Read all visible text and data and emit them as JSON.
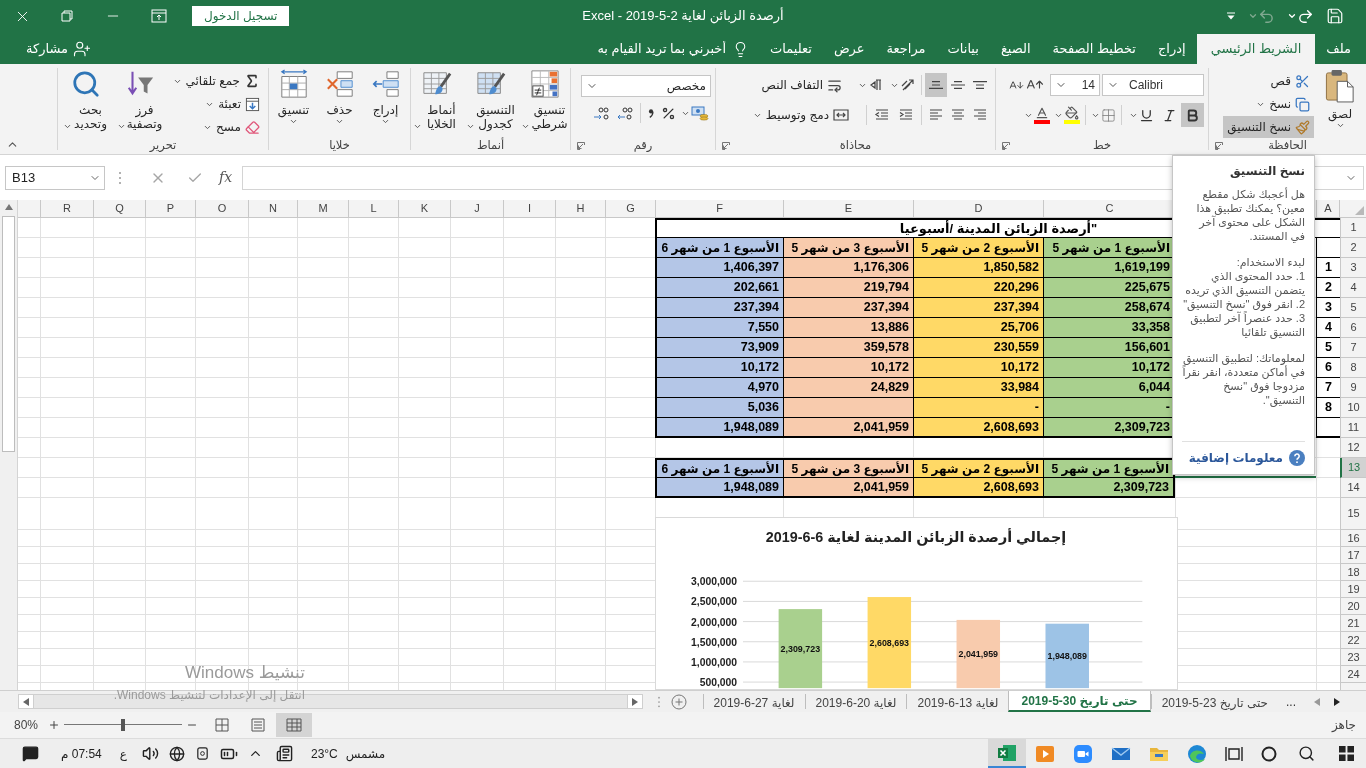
{
  "title_bar": {
    "title": "أرصدة الزبائن لغاية 2-5-2019 - Excel",
    "sign_in": "تسجيل الدخول"
  },
  "ribbon_tabs": [
    {
      "label": "ملف",
      "selected": false
    },
    {
      "label": "الشريط الرئيسي",
      "selected": true
    },
    {
      "label": "إدراج",
      "selected": false
    },
    {
      "label": "تخطيط الصفحة",
      "selected": false
    },
    {
      "label": "الصيغ",
      "selected": false
    },
    {
      "label": "بيانات",
      "selected": false
    },
    {
      "label": "مراجعة",
      "selected": false
    },
    {
      "label": "عرض",
      "selected": false
    },
    {
      "label": "تعليمات",
      "selected": false
    }
  ],
  "tell_me": {
    "placeholder": "أخبرني بما تريد القيام به"
  },
  "share": "مشاركة",
  "ribbon": {
    "clipboard": {
      "label": "الحافظة",
      "paste": "لصق",
      "cut": "قص",
      "copy": "نسخ",
      "format_painter": {
        "label": "نسخ التنسيق",
        "highlighted": true
      }
    },
    "font": {
      "label": "خط",
      "font_name": "Calibri",
      "font_size": "14",
      "bold": true,
      "italic": false,
      "underline": false
    },
    "alignment": {
      "label": "محاذاة",
      "wrap_text": "التفاف النص",
      "merge_center": "دمج وتوسيط",
      "vertical_align": [
        {
          "selected": false
        },
        {
          "selected": false
        },
        {
          "selected": true
        }
      ]
    },
    "number": {
      "label": "رقم",
      "format": "مخصص"
    },
    "styles": {
      "label": "أنماط",
      "buttons": [
        "تنسيق شرطي",
        "التنسيق كجدول",
        "أنماط الخلايا"
      ]
    },
    "cells": {
      "label": "خلايا",
      "buttons": [
        "إدراج",
        "حذف",
        "تنسيق"
      ]
    },
    "editing": {
      "label": "تحرير",
      "autosum": "جمع تلقائي",
      "fill": "تعبئة",
      "clear": "مسح",
      "sort_filter": "فرز وتصفية",
      "find_select": "بحث وتحديد"
    }
  },
  "formula_bar": {
    "name_box": "B13",
    "insert_function": "fx"
  },
  "sheet": {
    "columns": [
      "A",
      null,
      "C",
      "D",
      "E",
      "F",
      "G",
      "H",
      "I",
      "J",
      "K",
      "L",
      "M",
      "N",
      "O",
      "P",
      "Q",
      "R"
    ],
    "rows": [
      {
        "label": "1",
        "selected": false
      },
      {
        "label": "2",
        "selected": false
      },
      {
        "label": "3",
        "selected": false
      },
      {
        "label": "4",
        "selected": false
      },
      {
        "label": "5",
        "selected": false
      },
      {
        "label": "6",
        "selected": false
      },
      {
        "label": "7",
        "selected": false
      },
      {
        "label": "8",
        "selected": false
      },
      {
        "label": "9",
        "selected": false
      },
      {
        "label": "10",
        "selected": false
      },
      {
        "label": "11",
        "selected": false
      },
      {
        "label": "12",
        "selected": false
      },
      {
        "label": "13",
        "selected": true
      },
      {
        "label": "14",
        "selected": false
      },
      {
        "label": "15",
        "selected": false
      },
      {
        "label": "16",
        "selected": false
      },
      {
        "label": "17",
        "selected": false
      },
      {
        "label": "18",
        "selected": false
      },
      {
        "label": "19",
        "selected": false
      },
      {
        "label": "20",
        "selected": false
      },
      {
        "label": "21",
        "selected": false
      },
      {
        "label": "22",
        "selected": false
      },
      {
        "label": "23",
        "selected": false
      },
      {
        "label": "24",
        "selected": false
      }
    ],
    "table": {
      "title": "\"أرصدة الزبائن المدينة /أسبوعيا",
      "serials": [
        "1",
        "2",
        "3",
        "4",
        "5",
        "6",
        "7",
        "8"
      ],
      "columns": [
        {
          "header": "الأسبوع 1 من شهر 5",
          "color": "#a9d08e",
          "values": [
            "1,619,199",
            "225,675",
            "258,674",
            "33,358",
            "156,601",
            "10,172",
            "6,044",
            "-"
          ],
          "total": "2,309,723"
        },
        {
          "header": "الأسبوع 2 من شهر 5",
          "color": "#ffd966",
          "values": [
            "1,850,582",
            "220,296",
            "237,394",
            "25,706",
            "230,559",
            "10,172",
            "33,984",
            "-"
          ],
          "total": "2,608,693"
        },
        {
          "header": "الأسبوع 3 من شهر 5",
          "color": "#f8cbad",
          "values": [
            "1,176,306",
            "219,794",
            "237,394",
            "13,886",
            "359,578",
            "10,172",
            "24,829"
          ],
          "total": "2,041,959"
        },
        {
          "header": "الأسبوع 1 من شهر 6",
          "color": "#b4c6e7",
          "values": [
            "1,406,397",
            "202,661",
            "237,394",
            "7,550",
            "73,909",
            "10,172",
            "4,970",
            "5,036"
          ],
          "total": "1,948,089"
        }
      ]
    },
    "summary": {
      "columns": [
        {
          "header": "الأسبوع 1 من شهر 5",
          "color": "#a9d08e",
          "total": "2,309,723"
        },
        {
          "header": "الأسبوع 2 من شهر 5",
          "color": "#ffd966",
          "total": "2,608,693"
        },
        {
          "header": "الأسبوع 3 من شهر 5",
          "color": "#f8cbad",
          "total": "2,041,959"
        },
        {
          "header": "الأسبوع 1 من شهر 6",
          "color": "#b4c6e7",
          "total": "1,948,089"
        }
      ]
    },
    "chart": {
      "chart_data": [
        {
          "type": "bar",
          "title": "إجمالي أرصدة الزبائن المدينة لغاية 6-6-2019",
          "categories": [
            null,
            null,
            null,
            null
          ],
          "values": [
            2309723,
            2608693,
            2041959,
            1948089
          ],
          "colors": [
            "#a9d08e",
            "#ffd966",
            "#f8cbad",
            "#9dc3e6"
          ],
          "ylim": [
            350000,
            3000000
          ],
          "yticks": [
            {
              "value": 500000,
              "label": "500,000"
            },
            {
              "value": 1000000,
              "label": "1,000,000"
            },
            {
              "value": 1500000,
              "label": "1,500,000"
            },
            {
              "value": 2000000,
              "label": "2,000,000"
            },
            {
              "value": 2500000,
              "label": "2,500,000"
            },
            {
              "value": 3000000,
              "label": "3,000,000"
            }
          ],
          "data_labels": true,
          "value_labels": [
            "2,309,723",
            "2,608,693",
            "2,041,959",
            "1,948,089"
          ],
          "grid": true
        }
      ]
    }
  },
  "tooltip": {
    "title": "نسخ التنسيق",
    "intro": "هل أعجبك شكل مقطع معين؟ يمكنك تطبيق هذا الشكل على محتوى آخر في المستند.",
    "steps_heading": "لبدء الاستخدام:",
    "steps": [
      "1. حدد المحتوى الذي يتضمن التنسيق الذي تريده",
      "2. انقر فوق \"نسخ التنسيق\"",
      "3. حدد عنصراً آخر لتطبيق التنسيق تلقائيا"
    ],
    "note": "لمعلوماتك: لتطبيق التنسيق في أماكن متعددة، انقر نقراً مزدوجا فوق \"نسخ التنسيق\".",
    "link": "معلومات إضافية"
  },
  "sheet_tabs": {
    "more": "...",
    "tabs": [
      {
        "label": "حتى تاريخ 23-5-2019",
        "selected": false
      },
      {
        "label": "حتى تاريخ 30-5-2019",
        "selected": true
      },
      {
        "label": "لغاية 13-6-2019",
        "selected": false
      },
      {
        "label": "لغاية 20-6-2019",
        "selected": false
      },
      {
        "label": "لغاية 27-6-2019",
        "selected": false
      }
    ]
  },
  "status_bar": {
    "status": "جاهز",
    "views": [
      {
        "selected": true
      },
      {
        "selected": false
      },
      {
        "selected": false
      }
    ],
    "zoom_slider": {
      "level": 0.5
    },
    "zoom": "80%"
  },
  "activation": {
    "title": "تنشيط Windows",
    "text": "انتقل إلى الإعدادات لتنشيط Windows."
  },
  "taskbar": {
    "apps": [
      {
        "kind": "browser",
        "active": false
      },
      {
        "kind": "folder",
        "active": false
      },
      {
        "kind": "mail",
        "active": false
      },
      {
        "kind": "video",
        "active": false
      },
      {
        "kind": "media",
        "active": false
      },
      {
        "kind": "spreadsheet",
        "active": true
      }
    ],
    "weather": "مشمس",
    "temperature": "23°C",
    "language": "ع",
    "time": "07:54 م"
  }
}
